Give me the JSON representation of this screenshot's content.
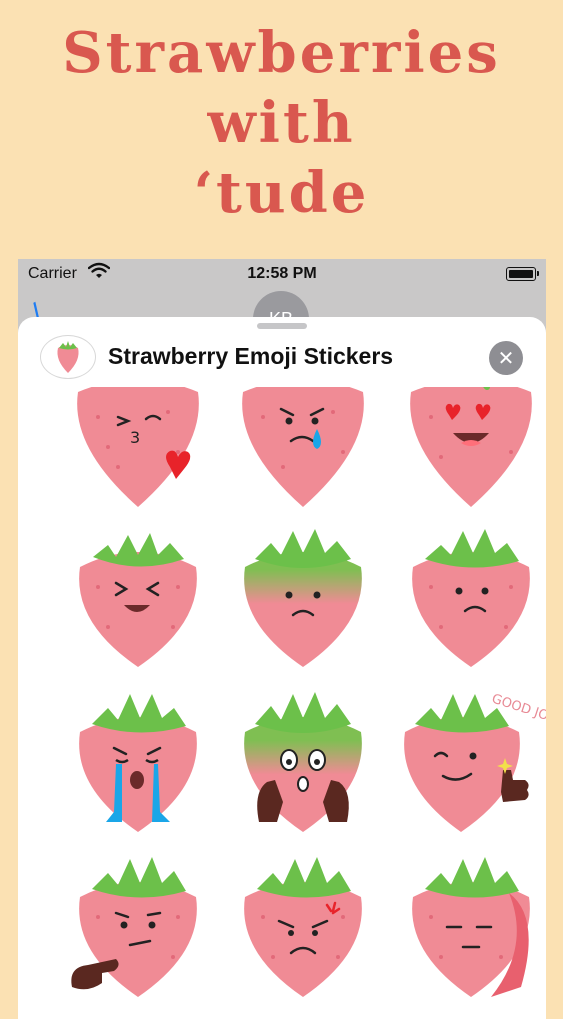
{
  "promo": {
    "line1": "Strawberries",
    "line2": "with",
    "line3": "‘tude"
  },
  "status": {
    "carrier": "Carrier",
    "time": "12:58 PM"
  },
  "contact": {
    "initials": "KB"
  },
  "sheet": {
    "title": "Strawberry Emoji Stickers",
    "close_label": "✕"
  },
  "stickers": [
    {
      "name": "kiss-heart"
    },
    {
      "name": "sad-tear"
    },
    {
      "name": "heart-eyes"
    },
    {
      "name": "laughing"
    },
    {
      "name": "worried-green"
    },
    {
      "name": "frown"
    },
    {
      "name": "crying"
    },
    {
      "name": "shocked"
    },
    {
      "name": "good-job",
      "caption": "GOOD JOB!"
    },
    {
      "name": "thinking"
    },
    {
      "name": "angry"
    },
    {
      "name": "unamused"
    }
  ],
  "colors": {
    "background": "#fbe1b3",
    "title": "#d9584f",
    "strawberry": "#f08b95",
    "leaves": "#6cc04a",
    "heart": "#e8232a",
    "tear": "#1aa6e8"
  }
}
